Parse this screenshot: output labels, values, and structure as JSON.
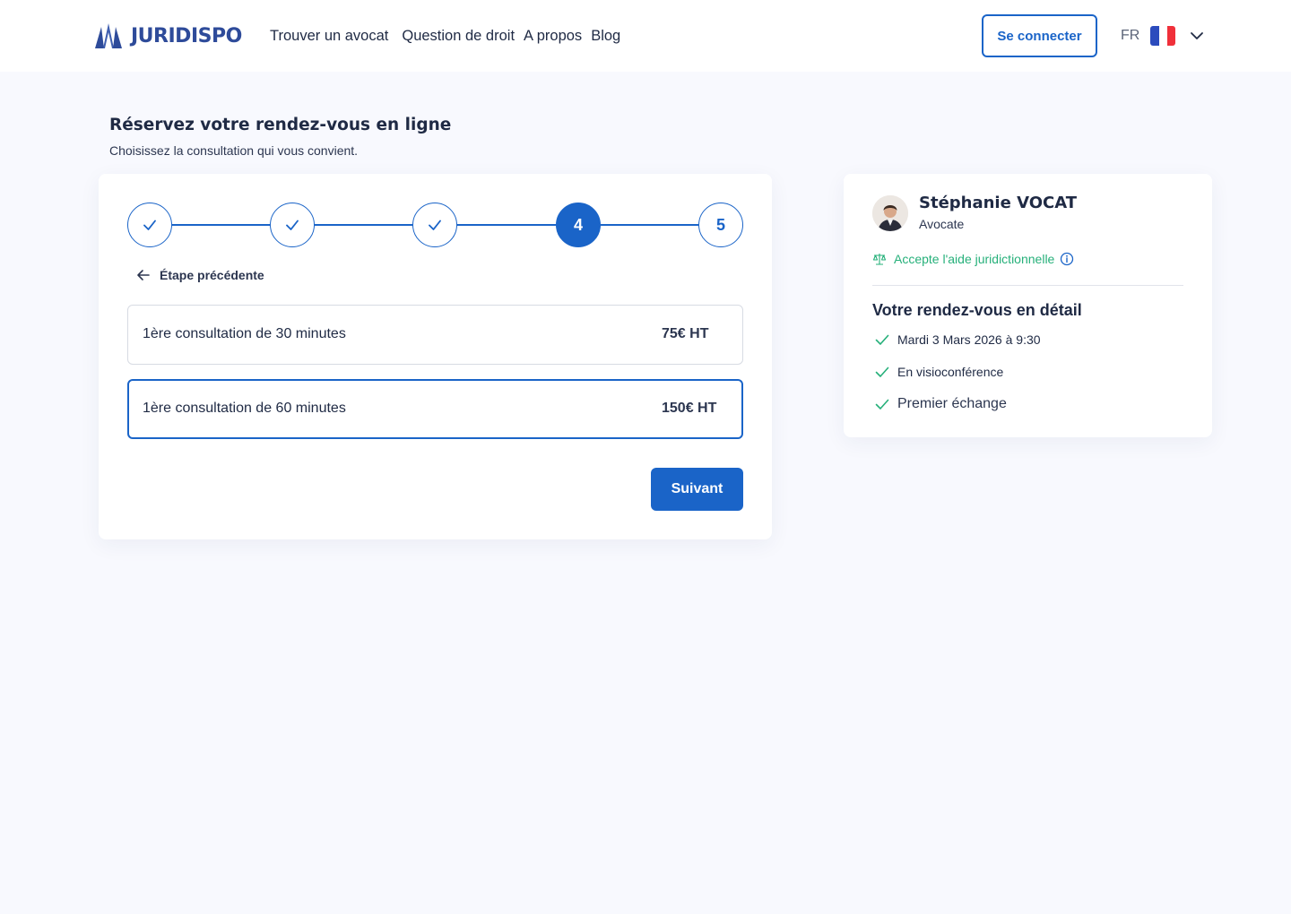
{
  "brand": {
    "name": "JURIDISPO",
    "color": "#2e4b9a"
  },
  "nav": {
    "items": [
      {
        "label": "Trouver un avocat"
      },
      {
        "label": "Question de droit"
      },
      {
        "label": "A propos"
      },
      {
        "label": "Blog"
      }
    ]
  },
  "header": {
    "login_label": "Se connecter",
    "language": {
      "code": "FR",
      "flag": "france-flag-icon"
    }
  },
  "booking": {
    "title": "Réservez votre rendez-vous en ligne",
    "subtitle": "Choisissez la consultation qui vous convient.",
    "steps": [
      {
        "label": "",
        "state": "done"
      },
      {
        "label": "",
        "state": "done"
      },
      {
        "label": "",
        "state": "done"
      },
      {
        "label": "4",
        "state": "current"
      },
      {
        "label": "5",
        "state": "upcoming"
      }
    ],
    "back_label": "Étape précédente",
    "options": [
      {
        "label": "1ère consultation de 30 minutes",
        "price": "75€ HT",
        "selected": false
      },
      {
        "label": "1ère consultation de 60 minutes",
        "price": "150€ HT",
        "selected": true
      }
    ],
    "next_label": "Suivant"
  },
  "lawyer": {
    "name": "Stéphanie VOCAT",
    "role": "Avocate",
    "legal_aid": "Accepte l'aide juridictionnelle",
    "details_title": "Votre rendez-vous en détail",
    "details": [
      "Mardi 3 Mars 2026 à 9:30",
      "En visioconférence",
      "Premier échange"
    ]
  },
  "colors": {
    "primary": "#1a64c8",
    "success": "#26b07a",
    "background": "#f8f9fe"
  }
}
